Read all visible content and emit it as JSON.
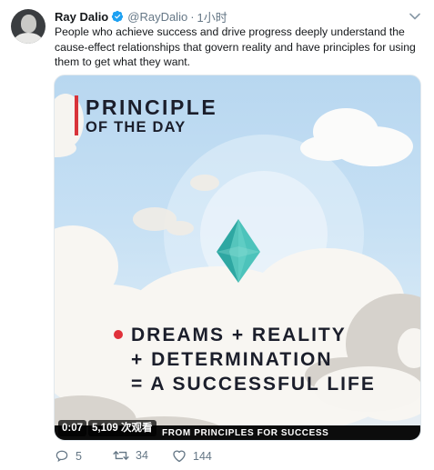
{
  "tweet": {
    "author_name": "Ray Dalio",
    "handle": "@RayDalio",
    "separator": "·",
    "time": "1小时",
    "text": "People who achieve success and drive progress deeply understand the cause-effect relationships that govern reality and have principles for using them to get what they want."
  },
  "video": {
    "title_line1": "PRINCIPLE",
    "title_line2": "OF THE DAY",
    "equation": [
      "DREAMS + REALITY",
      "+ DETERMINATION",
      "= A SUCCESSFUL LIFE"
    ],
    "footer_credit": "FROM PRINCIPLES FOR SUCCESS",
    "duration": "0:07",
    "views": "5,109 次观看"
  },
  "actions": {
    "reply_count": "5",
    "retweet_count": "34",
    "like_count": "144"
  },
  "icons": {
    "verified": "verified-badge-icon",
    "caret": "chevron-down-icon",
    "reply": "reply-icon",
    "retweet": "retweet-icon",
    "like": "heart-icon"
  },
  "colors": {
    "verified_blue": "#1da1f2",
    "accent_red": "#d8333a",
    "muted_text": "#657786",
    "crystal_teal": "#3fb8b0"
  }
}
